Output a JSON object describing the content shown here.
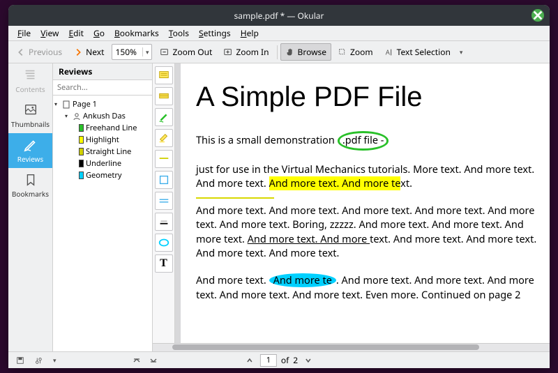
{
  "window": {
    "title": "sample.pdf * — Okular"
  },
  "menubar": {
    "items": [
      "File",
      "View",
      "Edit",
      "Go",
      "Bookmarks",
      "Tools",
      "Settings",
      "Help"
    ]
  },
  "toolbar": {
    "previous": "Previous",
    "next": "Next",
    "zoom_value": "150%",
    "zoom_out": "Zoom Out",
    "zoom_in": "Zoom In",
    "browse": "Browse",
    "zoom": "Zoom",
    "text_selection": "Text Selection"
  },
  "sidebar": {
    "tabs": {
      "contents": "Contents",
      "thumbnails": "Thumbnails",
      "reviews": "Reviews",
      "bookmarks": "Bookmarks"
    }
  },
  "reviews": {
    "title": "Reviews",
    "search_placeholder": "Search...",
    "tree": {
      "page": "Page 1",
      "author": "Ankush Das",
      "items": [
        {
          "label": "Freehand Line",
          "color": "#29c029"
        },
        {
          "label": "Highlight",
          "color": "#ffff00"
        },
        {
          "label": "Straight Line",
          "color": "#d0d000"
        },
        {
          "label": "Underline",
          "color": "#000000"
        },
        {
          "label": "Geometry",
          "color": "#00d0ff"
        }
      ]
    }
  },
  "document": {
    "title": "A Simple PDF File",
    "p1_before": "This is a small demonstration",
    "p1_circle": ".pdf file -",
    "p2_a": "just for use in the Virtual Mechanics tutorials. More text. And more text. And more text. ",
    "p2_hl": "And more text. And more te",
    "p2_b": "xt.",
    "p3_a": "And more text. And more text. And more text. And more text. And more text. And more text. Boring, zzzzz. And more text. And more text. And more text. ",
    "p3_ul": "And more text. And more ",
    "p3_b": "text. And more text. And more text. And more text. And more text.",
    "p4_a": "And more text. ",
    "p4_cyan": "And more te",
    "p4_b": ". And more text. And more text. And more text. And more text. And more text. Even more. Continued on page 2"
  },
  "statusbar": {
    "current_page": "1",
    "of": "of",
    "total_pages": "2"
  }
}
